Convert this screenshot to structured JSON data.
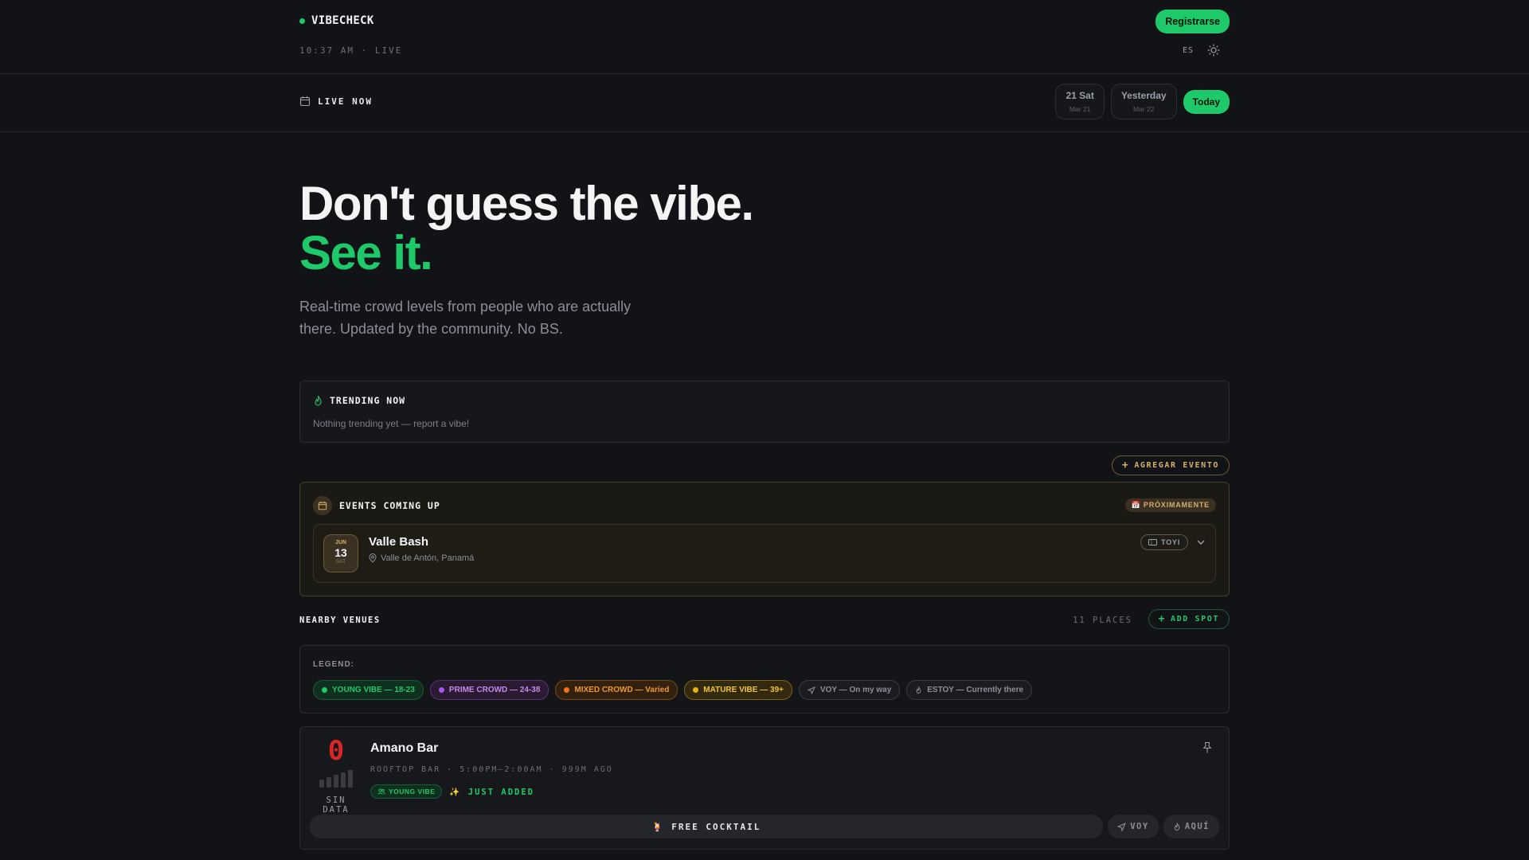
{
  "header": {
    "brand": "VIBECHECK",
    "clock": "10:37 AM · LIVE",
    "register_label": "Registrarse",
    "lang": "ES"
  },
  "live": {
    "label": "LIVE NOW",
    "dates": [
      {
        "day": "21 Sat",
        "date": "Mar 21"
      },
      {
        "day": "Yesterday",
        "date": "Mar 22"
      }
    ],
    "today_label": "Today"
  },
  "hero": {
    "title_line1": "Don't guess the vibe.",
    "title_line2": "See it.",
    "subtitle": "Real-time crowd levels from people who are actually there. Updated by the community. No BS."
  },
  "trending": {
    "title": "TRENDING NOW",
    "empty_text": "Nothing trending yet — report a vibe!"
  },
  "events": {
    "add_label": "AGREGAR EVENTO",
    "title": "EVENTS COMING UP",
    "badge": "📅 PRÓXIMAMENTE",
    "items": [
      {
        "month": "JUN",
        "day": "13",
        "weekday": "SAT",
        "name": "Valle Bash",
        "location": "Valle de Antón, Panamá",
        "ticket_label": "TOYI"
      }
    ]
  },
  "nearby": {
    "title": "NEARBY VENUES",
    "count": "11 PLACES",
    "add_label": "ADD SPOT"
  },
  "legend": {
    "title": "LEGEND:",
    "chips": [
      {
        "label": "YOUNG VIBE — 18-23",
        "color": "#1ec96a"
      },
      {
        "label": "PRIME CROWD — 24-38",
        "color": "#a855f7"
      },
      {
        "label": "MIXED CROWD — Varied",
        "color": "#f97316"
      },
      {
        "label": "MATURE VIBE — 39+",
        "color": "#eab308"
      },
      {
        "label": "VOY — On my way",
        "icon": "send-icon"
      },
      {
        "label": "ESTOY — Currently there",
        "icon": "flame-icon"
      }
    ]
  },
  "venue": {
    "score": "0",
    "score_label": "SIN DATA",
    "name": "Amano Bar",
    "meta": "ROOFTOP BAR · 5:00PM–2:00AM · 999M AGO",
    "tag": "YOUNG VIBE",
    "just_added": "✨ JUST ADDED",
    "promo": "🍹 FREE COCKTAIL",
    "voy_label": "VOY",
    "aqui_label": "AQUÍ"
  },
  "colors": {
    "accent": "#1ec96a",
    "background": "#121317",
    "score_red": "#dc2626",
    "event_gold": "#d4b06a"
  }
}
